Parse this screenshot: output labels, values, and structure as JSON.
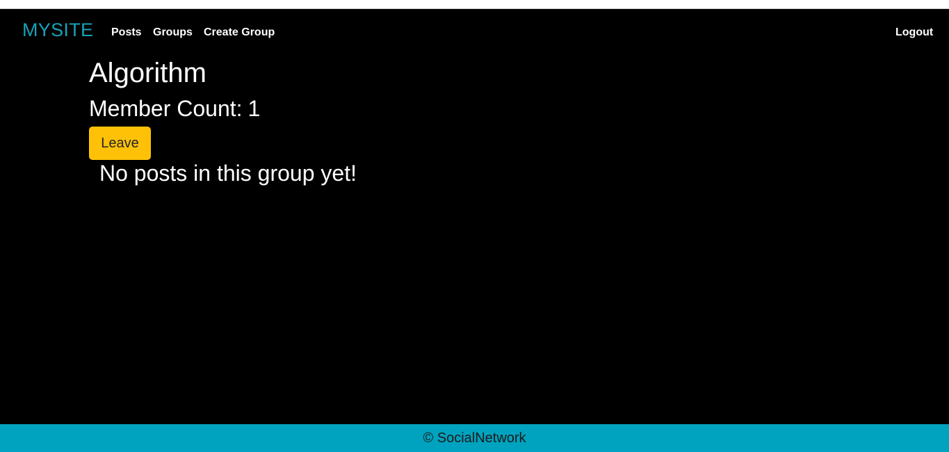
{
  "navbar": {
    "brand": "MYSITE",
    "links": [
      "Posts",
      "Groups",
      "Create Group"
    ],
    "logout": "Logout"
  },
  "group": {
    "title": "Algorithm",
    "member_count_label": "Member Count:",
    "member_count": "1",
    "leave_label": "Leave",
    "empty_message": "No posts in this group yet!"
  },
  "footer": {
    "text": "© SocialNetwork"
  },
  "colors": {
    "background": "#000000",
    "brand": "#17a2b8",
    "leave_button": "#ffc107",
    "footer": "#00a3bf"
  }
}
